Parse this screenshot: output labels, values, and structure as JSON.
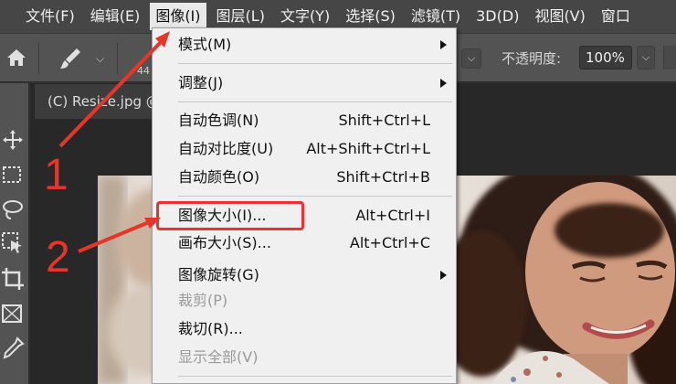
{
  "menubar": {
    "items": [
      "文件(F)",
      "编辑(E)",
      "图像(I)",
      "图层(L)",
      "文字(Y)",
      "选择(S)",
      "滤镜(T)",
      "3D(D)",
      "视图(V)",
      "窗口"
    ]
  },
  "options": {
    "brush_size": "44",
    "opacity_label": "不透明度:",
    "opacity_value": "100%"
  },
  "document": {
    "tab_title": "(C) Resize.jpg @"
  },
  "image_menu": {
    "mode": {
      "label": "模式(M)"
    },
    "adjust": {
      "label": "调整(J)"
    },
    "auto_tone": {
      "label": "自动色调(N)",
      "shortcut": "Shift+Ctrl+L"
    },
    "auto_contrast": {
      "label": "自动对比度(U)",
      "shortcut": "Alt+Shift+Ctrl+L"
    },
    "auto_color": {
      "label": "自动颜色(O)",
      "shortcut": "Shift+Ctrl+B"
    },
    "image_size": {
      "label": "图像大小(I)...",
      "shortcut": "Alt+Ctrl+I"
    },
    "canvas_size": {
      "label": "画布大小(S)...",
      "shortcut": "Alt+Ctrl+C"
    },
    "rotation": {
      "label": "图像旋转(G)"
    },
    "crop": {
      "label": "裁剪(P)"
    },
    "trim": {
      "label": "裁切(R)..."
    },
    "reveal_all": {
      "label": "显示全部(V)"
    }
  },
  "annotations": {
    "step1": "1",
    "step2": "2"
  },
  "colors": {
    "annotation_red": "#e8352a"
  }
}
